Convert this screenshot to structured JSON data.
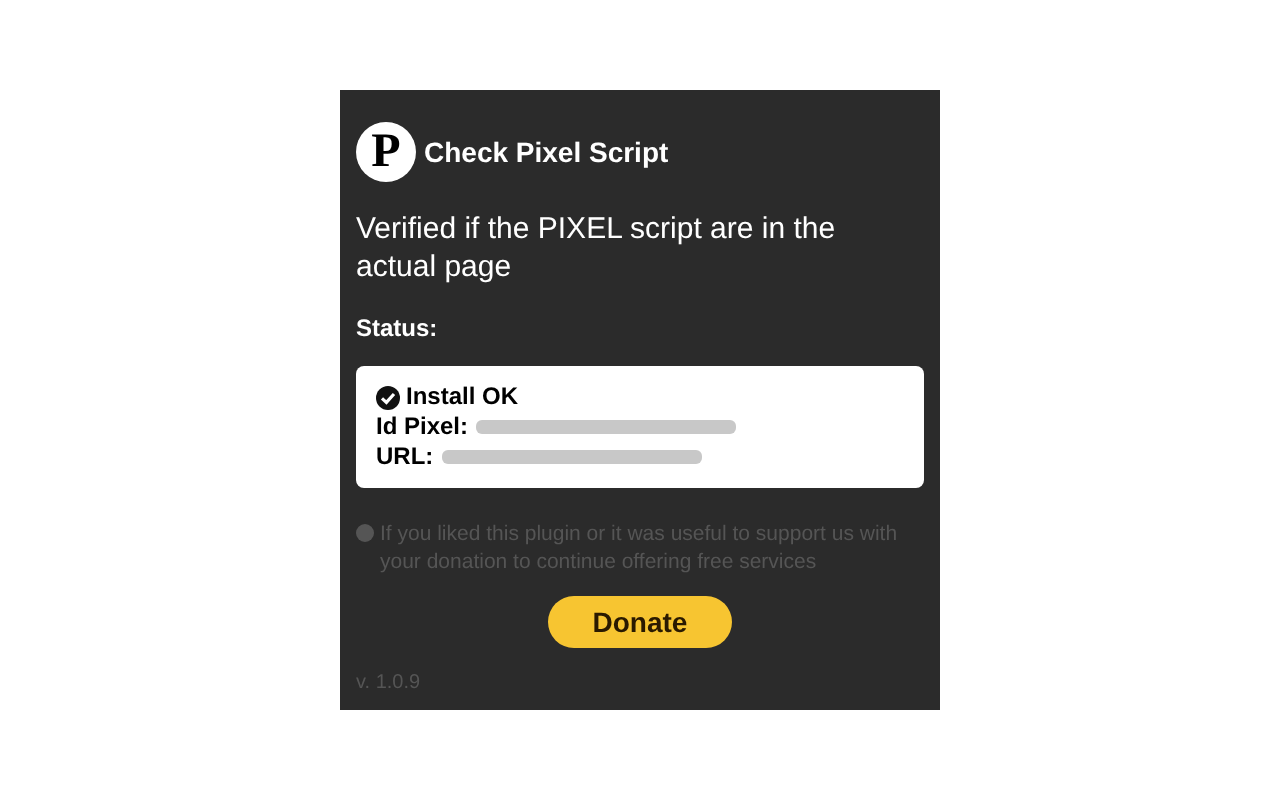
{
  "header": {
    "logo": "P",
    "title": "Check Pixel Script"
  },
  "description": "Verified if the PIXEL script are in the actual page",
  "status": {
    "label": "Status:",
    "result": "Install OK",
    "ok": true,
    "fields": [
      {
        "label": "Id Pixel:"
      },
      {
        "label": "URL:"
      }
    ]
  },
  "note": "If you liked this plugin or it was useful to support us with your donation to continue offering free services",
  "donate_button": "Donate",
  "version": "v. 1.0.9"
}
